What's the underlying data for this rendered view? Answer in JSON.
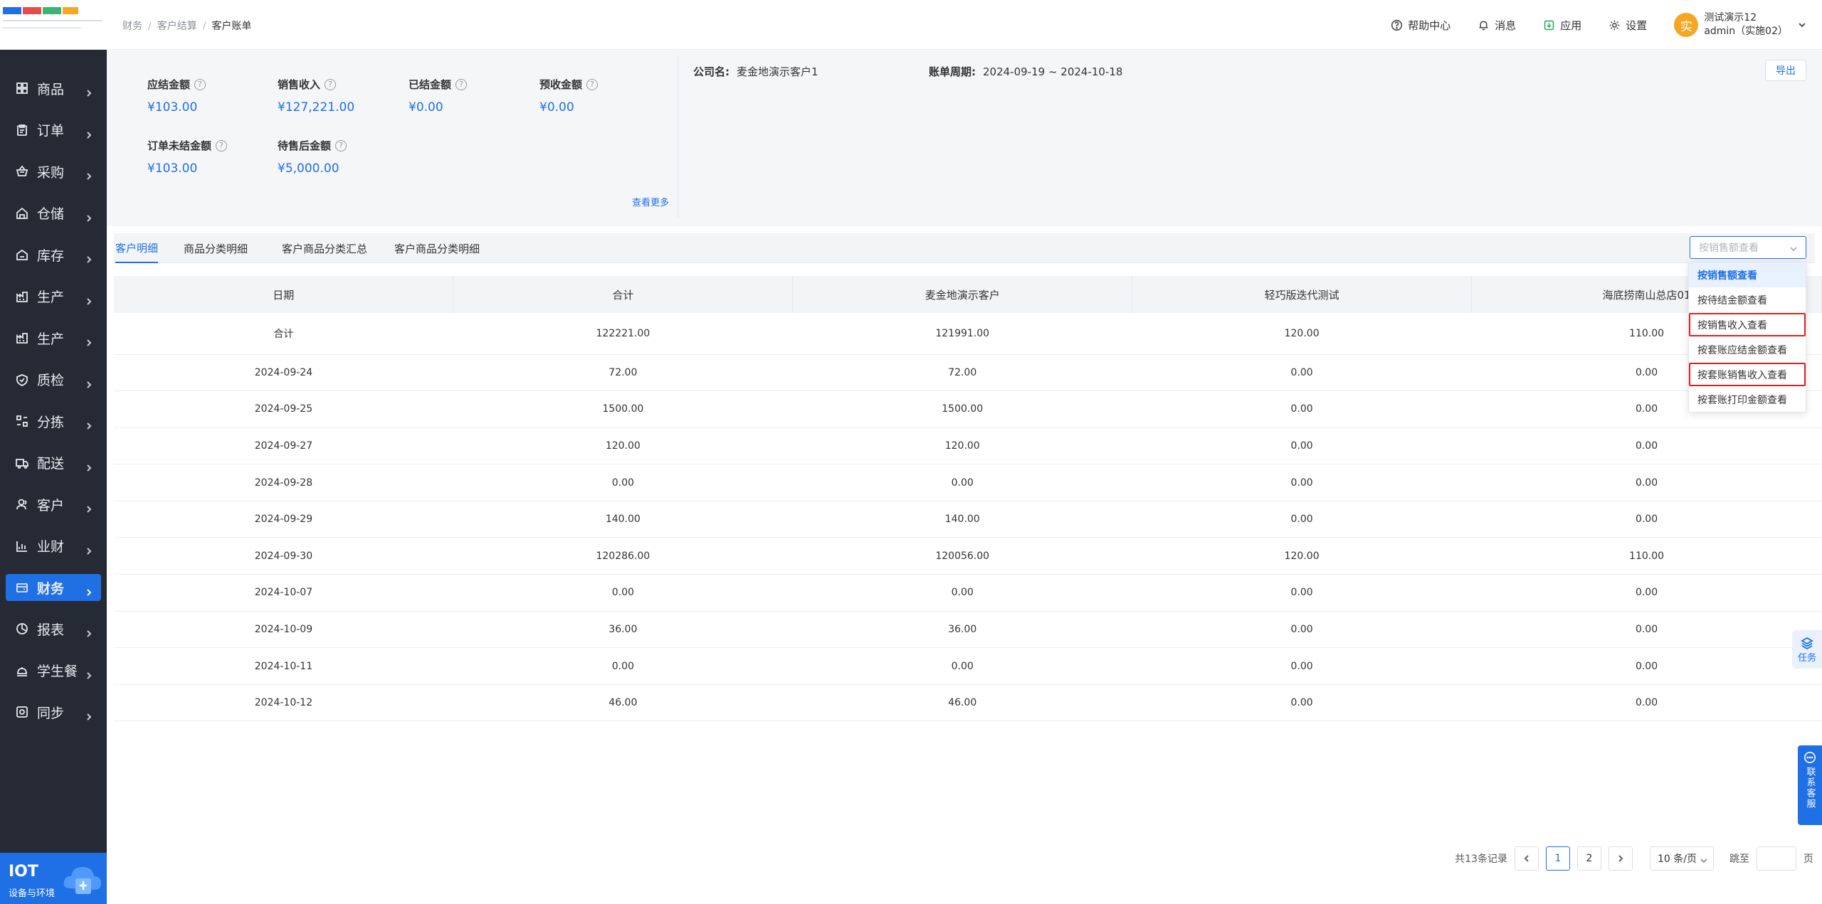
{
  "sidebar": {
    "items": [
      {
        "label": "商品",
        "icon": "grid-icon"
      },
      {
        "label": "订单",
        "icon": "clipboard-icon"
      },
      {
        "label": "采购",
        "icon": "basket-icon"
      },
      {
        "label": "仓储",
        "icon": "warehouse-icon"
      },
      {
        "label": "库存",
        "icon": "stock-icon"
      },
      {
        "label": "生产",
        "icon": "factory-icon"
      },
      {
        "label": "生产",
        "icon": "factory-icon"
      },
      {
        "label": "质检",
        "icon": "shield-icon"
      },
      {
        "label": "分拣",
        "icon": "sort-icon"
      },
      {
        "label": "配送",
        "icon": "truck-icon"
      },
      {
        "label": "客户",
        "icon": "user-icon"
      },
      {
        "label": "业财",
        "icon": "chart-icon"
      },
      {
        "label": "财务",
        "icon": "wallet-icon",
        "active": true
      },
      {
        "label": "报表",
        "icon": "pie-icon"
      },
      {
        "label": "学生餐",
        "icon": "meal-icon"
      },
      {
        "label": "同步",
        "icon": "sync-icon"
      }
    ],
    "iot": {
      "title": "IOT",
      "subtitle": "设备与环境"
    }
  },
  "header": {
    "breadcrumb": [
      "财务",
      "客户结算",
      "客户账单"
    ],
    "help": "帮助中心",
    "messages": "消息",
    "apps": "应用",
    "settings": "设置",
    "user": {
      "avatar": "实",
      "name": "测试演示12",
      "account": "admin（实施02）"
    }
  },
  "summary": {
    "receivable": {
      "label": "应结金额",
      "value": "¥103.00"
    },
    "sales_income": {
      "label": "销售收入",
      "value": "¥127,221.00"
    },
    "settled": {
      "label": "已结金额",
      "value": "¥0.00"
    },
    "prepaid": {
      "label": "预收金额",
      "value": "¥0.00"
    },
    "unsettled_order": {
      "label": "订单未结金额",
      "value": "¥103.00"
    },
    "after_sale": {
      "label": "待售后金额",
      "value": "¥5,000.00"
    },
    "more": "查看更多",
    "company_label": "公司名:",
    "company": "麦金地演示客户1",
    "period_label": "账单周期:",
    "period": "2024-09-19 ~ 2024-10-18",
    "export": "导出"
  },
  "tabs": [
    "客户明细",
    "商品分类明细",
    "客户商品分类汇总",
    "客户商品分类明细"
  ],
  "view_select": {
    "placeholder": "按销售额查看",
    "options": [
      {
        "label": "按销售额查看",
        "selected": true
      },
      {
        "label": "按待结金额查看"
      },
      {
        "label": "按销售收入查看",
        "highlight": true
      },
      {
        "label": "按套账应结金额查看"
      },
      {
        "label": "按套账销售收入查看",
        "highlight": true
      },
      {
        "label": "按套账打印金额查看"
      }
    ]
  },
  "table": {
    "headers": [
      "日期",
      "合计",
      "麦金地演示客户",
      "轻巧版迭代测试",
      "海底捞南山总店01"
    ],
    "rows": [
      [
        "合计",
        "122221.00",
        "121991.00",
        "120.00",
        "110.00"
      ],
      [
        "2024-09-24",
        "72.00",
        "72.00",
        "0.00",
        "0.00"
      ],
      [
        "2024-09-25",
        "1500.00",
        "1500.00",
        "0.00",
        "0.00"
      ],
      [
        "2024-09-27",
        "120.00",
        "120.00",
        "0.00",
        "0.00"
      ],
      [
        "2024-09-28",
        "0.00",
        "0.00",
        "0.00",
        "0.00"
      ],
      [
        "2024-09-29",
        "140.00",
        "140.00",
        "0.00",
        "0.00"
      ],
      [
        "2024-09-30",
        "120286.00",
        "120056.00",
        "120.00",
        "110.00"
      ],
      [
        "2024-10-07",
        "0.00",
        "0.00",
        "0.00",
        "0.00"
      ],
      [
        "2024-10-09",
        "36.00",
        "36.00",
        "0.00",
        "0.00"
      ],
      [
        "2024-10-11",
        "0.00",
        "0.00",
        "0.00",
        "0.00"
      ],
      [
        "2024-10-12",
        "46.00",
        "46.00",
        "0.00",
        "0.00"
      ]
    ]
  },
  "float": {
    "task": "任务",
    "service": "联系客服"
  },
  "pager": {
    "total": "共13条记录",
    "pages": [
      "1",
      "2"
    ],
    "current": "1",
    "size": "10 条/页",
    "jump": "跳至",
    "page_unit": "页"
  },
  "colors": {
    "primary": "#1f6fe5",
    "sidebar": "#262a35",
    "highlight": "#e02020"
  }
}
